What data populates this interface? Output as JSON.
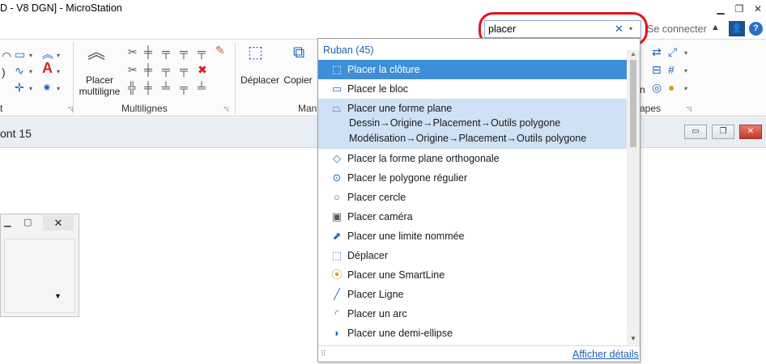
{
  "window": {
    "title": "D - V8 DGN] - MicroStation",
    "controls": [
      "minimize-icon",
      "restore-icon",
      "close-icon"
    ]
  },
  "search": {
    "value": "placer",
    "clear_glyph": "✕",
    "dropdown_glyph": "▾",
    "highlight_color": "#e8101e"
  },
  "account": {
    "connect_label": "Se connecter",
    "collapse_glyph": "▲",
    "help_glyph": "?"
  },
  "ribbon": {
    "groups": [
      {
        "label": "t"
      },
      {
        "label": "Multilignes"
      },
      {
        "label": "Man"
      },
      {
        "label": "apes"
      }
    ],
    "buttons": {
      "multiline": "Placer\nmultiligne",
      "multiline_line1": "Placer",
      "multiline_line2": "multiligne",
      "move": "Déplacer",
      "copy": "Copier"
    }
  },
  "document": {
    "title": "ont 15"
  },
  "results": {
    "header": "Ruban (45)",
    "items": [
      {
        "label": "Placer la clôture",
        "icon": "fence-icon",
        "state": "selected"
      },
      {
        "label": "Placer le bloc",
        "icon": "block-icon"
      },
      {
        "label": "Placer une forme plane",
        "icon": "shape-icon",
        "state": "highlighted",
        "paths": [
          "Dessin→Origine→Placement→Outils polygone",
          "Modélisation→Origine→Placement→Outils polygone"
        ]
      },
      {
        "label": "Placer la forme plane orthogonale",
        "icon": "orthogonal-shape-icon"
      },
      {
        "label": "Placer le polygone régulier",
        "icon": "polygon-icon"
      },
      {
        "label": "Placer cercle",
        "icon": "circle-icon"
      },
      {
        "label": "Placer caméra",
        "icon": "camera-icon"
      },
      {
        "label": "Placer une limite nommée",
        "icon": "named-boundary-icon"
      },
      {
        "label": "Déplacer",
        "icon": "move-icon"
      },
      {
        "label": "Placer une SmartLine",
        "icon": "smartline-icon"
      },
      {
        "label": "Placer Ligne",
        "icon": "line-icon"
      },
      {
        "label": "Placer un arc",
        "icon": "arc-icon"
      },
      {
        "label": "Placer une demi-ellipse",
        "icon": "half-ellipse-icon"
      }
    ],
    "details_link": "Afficher détails"
  },
  "colors": {
    "accent": "#1f5fb0",
    "selection": "#3e8fd9",
    "highlight": "#cfe1f4"
  }
}
